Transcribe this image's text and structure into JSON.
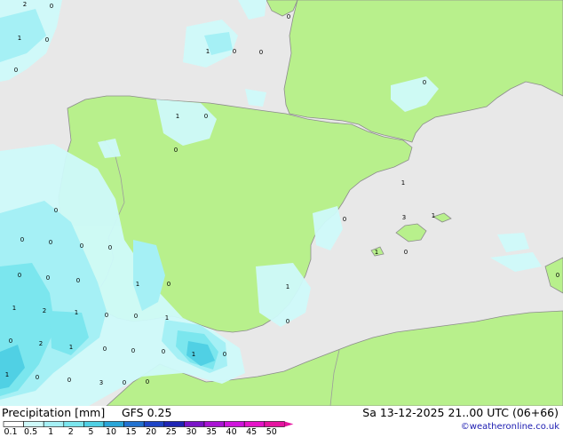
{
  "title": {
    "product": "Precipitation [mm]",
    "model": "GFS 0.25",
    "valid_time": "Sa 13-12-2025 21..00 UTC (06+66)"
  },
  "credit": "©weatheronline.co.uk",
  "colors": {
    "sea": "#e8e8e8",
    "land": "#b8f08c",
    "border": "#9c9c9c",
    "coast": "#8c8c8c"
  },
  "scale": {
    "ticks": [
      "0.1",
      "0.5",
      "1",
      "2",
      "5",
      "10",
      "15",
      "20",
      "25",
      "30",
      "35",
      "40",
      "45",
      "50"
    ],
    "colors": [
      "#ffffff",
      "#cffafa",
      "#a5f0f5",
      "#7be6ee",
      "#50d0e4",
      "#2aa6d8",
      "#2272d0",
      "#1e44c6",
      "#1e24b4",
      "#7a14c8",
      "#aa14d4",
      "#d014dc",
      "#e614c8",
      "#e614a0"
    ]
  },
  "map_labels": [
    "2",
    "0",
    "1",
    "0",
    "0",
    "1",
    "0",
    "0",
    "0",
    "1",
    "0",
    "0",
    "0",
    "0",
    "0",
    "0",
    "0",
    "0",
    "0",
    "0",
    "0",
    "1",
    "0",
    "1",
    "1",
    "2",
    "1",
    "0",
    "0",
    "1",
    "0",
    "0",
    "2",
    "1",
    "0",
    "0",
    "0",
    "1",
    "0",
    "1",
    "0",
    "0",
    "3",
    "0",
    "1",
    "3",
    "1",
    "1",
    "0",
    "0",
    "0",
    "0"
  ]
}
